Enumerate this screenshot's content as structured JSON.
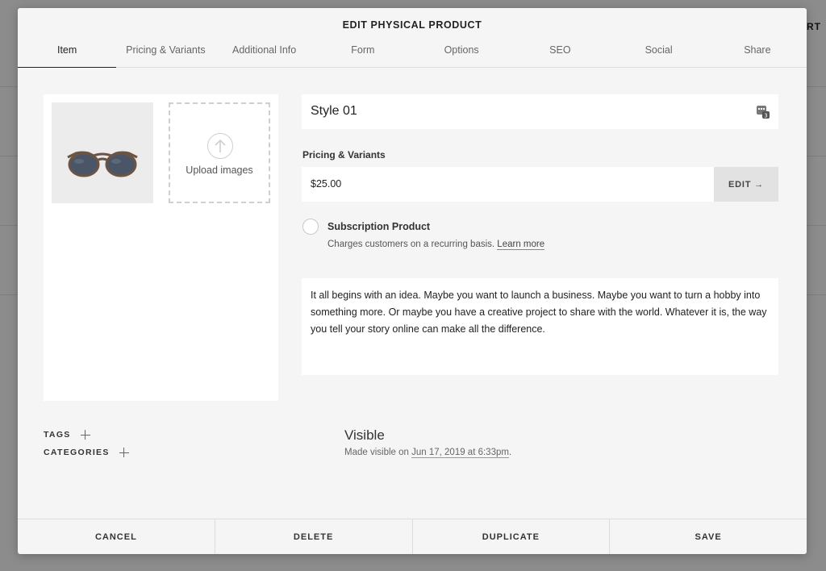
{
  "background": {
    "partial_text": "ORT"
  },
  "modal": {
    "title": "EDIT PHYSICAL PRODUCT",
    "tabs": [
      "Item",
      "Pricing & Variants",
      "Additional Info",
      "Form",
      "Options",
      "SEO",
      "Social",
      "Share"
    ],
    "active_tab": "Item"
  },
  "images": {
    "upload_label": "Upload images"
  },
  "product": {
    "title": "Style 01",
    "title_icon": "variant-stack-icon"
  },
  "pricing": {
    "label": "Pricing & Variants",
    "price": "$25.00",
    "edit_label": "EDIT →"
  },
  "subscription": {
    "title": "Subscription Product",
    "description": "Charges customers on a recurring basis.",
    "link": "Learn more"
  },
  "description": "It all begins with an idea. Maybe you want to launch a business. Maybe you want to turn a hobby into something more. Or maybe you have a creative project to share with the world. Whatever it is, the way you tell your story online can make all the difference.",
  "meta": {
    "tags_label": "TAGS",
    "categories_label": "CATEGORIES"
  },
  "visibility": {
    "title": "Visible",
    "prefix": "Made visible on",
    "date": "Jun 17, 2019 at 6:33pm",
    "suffix": "."
  },
  "footer": {
    "cancel": "CANCEL",
    "delete": "DELETE",
    "duplicate": "DUPLICATE",
    "save": "SAVE"
  }
}
